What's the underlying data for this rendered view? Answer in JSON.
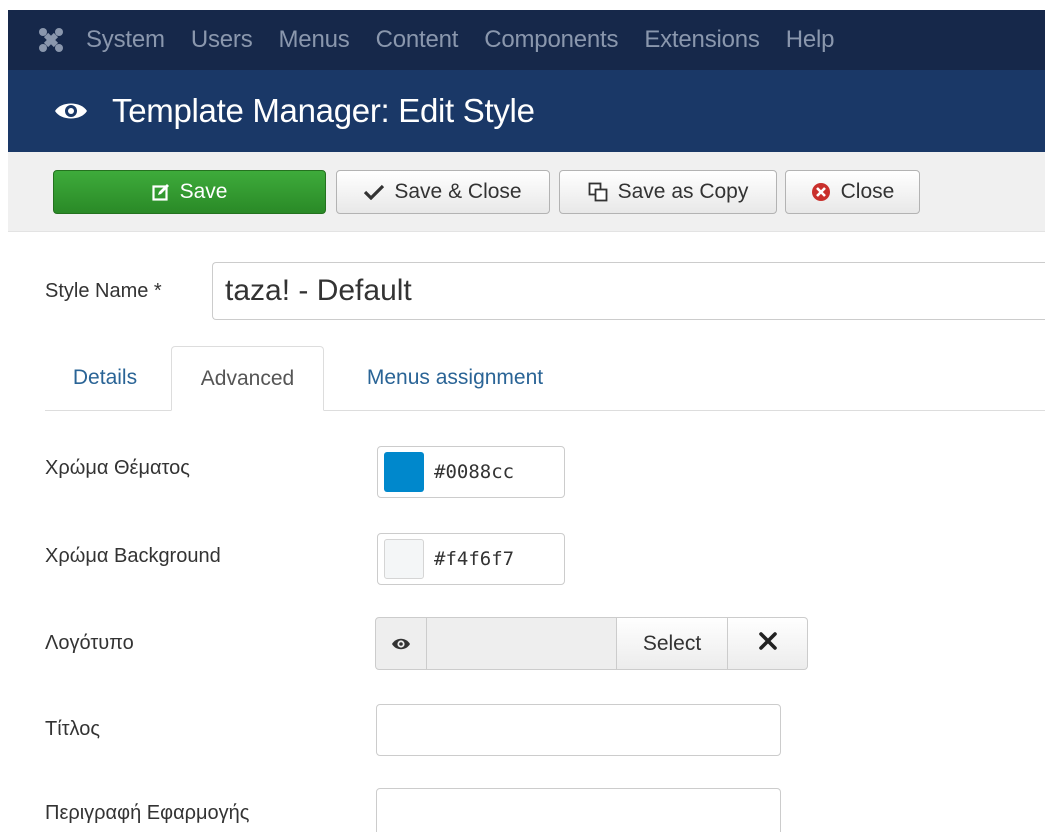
{
  "nav": {
    "items": [
      "System",
      "Users",
      "Menus",
      "Content",
      "Components",
      "Extensions",
      "Help"
    ]
  },
  "header": {
    "title": "Template Manager: Edit Style",
    "icon": "eye-icon"
  },
  "toolbar": {
    "save_label": "Save",
    "save_close_label": "Save & Close",
    "save_copy_label": "Save as Copy",
    "close_label": "Close"
  },
  "style_name": {
    "label": "Style Name *",
    "value": "taza! - Default"
  },
  "tabs": [
    {
      "label": "Details"
    },
    {
      "label": "Advanced"
    },
    {
      "label": "Menus assignment"
    }
  ],
  "fields": {
    "theme_color": {
      "label": "Χρώμα Θέματος",
      "value": "#0088cc"
    },
    "background_color": {
      "label": "Χρώμα Background",
      "value": "#f4f6f7"
    },
    "logo": {
      "label": "Λογότυπο",
      "select_label": "Select"
    },
    "title": {
      "label": "Τίτλος",
      "value": ""
    },
    "app_description": {
      "label": "Περιγραφή Εφαρμογής",
      "value": ""
    }
  },
  "colors": {
    "nav_bg": "#16284a",
    "header_bg": "#1a3867",
    "save_green": "#2f9a2c",
    "theme_swatch": "#0088cc",
    "background_swatch": "#f4f6f7"
  }
}
